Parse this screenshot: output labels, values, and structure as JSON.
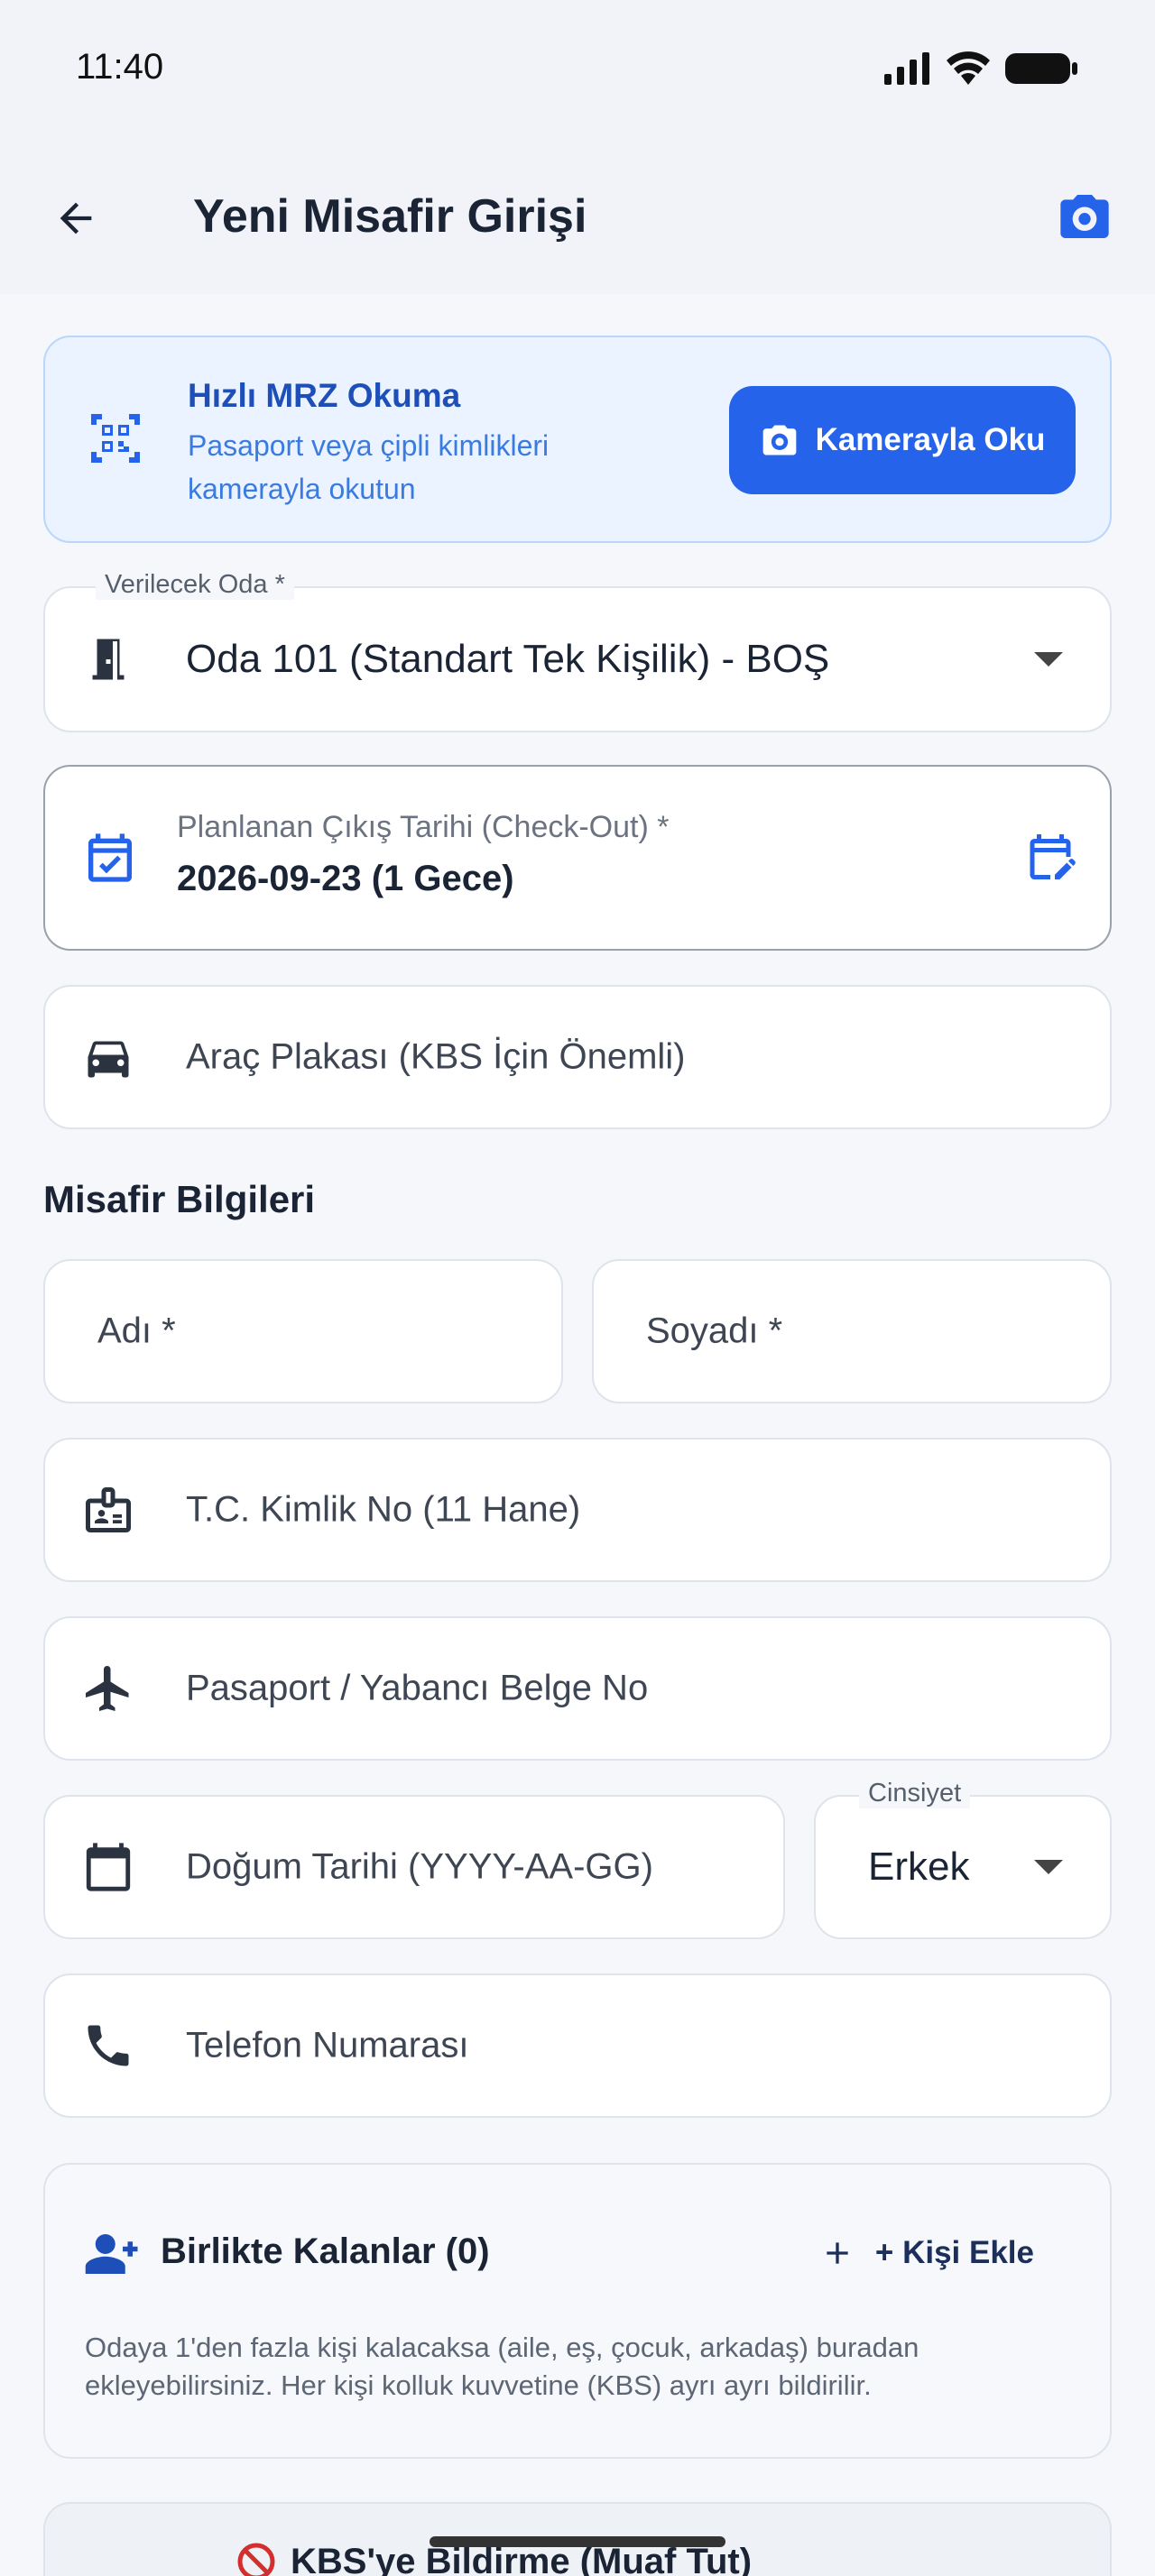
{
  "status_bar": {
    "time": "11:40"
  },
  "app_bar": {
    "title": "Yeni Misafir Girişi"
  },
  "mrz": {
    "title": "Hızlı MRZ Okuma",
    "description": "Pasaport veya çipli kimlikleri kamerayla okutun",
    "button_label": "Kamerayla Oku"
  },
  "room": {
    "label": "Verilecek Oda *",
    "value": "Oda 101 (Standart Tek Kişilik) - BOŞ"
  },
  "checkout": {
    "label": "Planlanan Çıkış Tarihi (Check-Out) *",
    "value": "2026-09-23 (1 Gece)"
  },
  "plate": {
    "placeholder": "Araç Plakası (KBS İçin Önemli)"
  },
  "guest_section": {
    "title": "Misafir Bilgileri",
    "first_name_placeholder": "Adı *",
    "last_name_placeholder": "Soyadı *",
    "tc_placeholder": "T.C. Kimlik No (11 Hane)",
    "passport_placeholder": "Pasaport / Yabancı Belge No",
    "birth_placeholder": "Doğum Tarihi (YYYY-AA-GG)",
    "gender_label": "Cinsiyet",
    "gender_value": "Erkek",
    "phone_placeholder": "Telefon Numarası"
  },
  "companions": {
    "title": "Birlikte Kalanlar (0)",
    "add_label": "+ Kişi Ekle",
    "description": "Odaya 1'den fazla kişi kalacaksa (aile, eş, çocuk, arkadaş) buradan ekleyebilirsiniz. Her kişi kolluk kuvvetine (KBS) ayrı ayrı bildirilir."
  },
  "kbs_exempt": {
    "label": "KBS'ye Bildirme (Muaf Tut)"
  },
  "colors": {
    "primary": "#2563eb",
    "mrz_bg": "#eaf3ff",
    "background": "#f5f7fb"
  }
}
